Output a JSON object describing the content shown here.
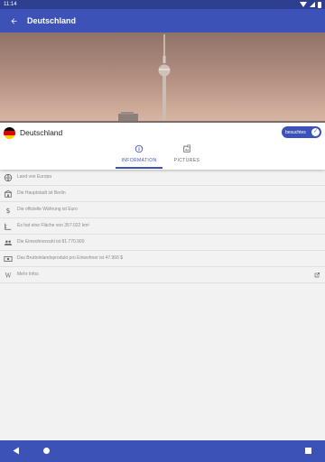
{
  "status_bar": {
    "time": "11:14"
  },
  "app_bar": {
    "title": "Deutschland"
  },
  "country": {
    "name": "Deutschland",
    "flag_colors": [
      "#000000",
      "#dd0000",
      "#ffce00"
    ],
    "visited_label": "besuchtes"
  },
  "tabs": [
    {
      "label": "INFORMATION",
      "icon": "info-icon",
      "selected": true
    },
    {
      "label": "PICTURES",
      "icon": "pictures-icon",
      "selected": false
    }
  ],
  "info_items": [
    {
      "icon": "globe-icon",
      "text": "Land von Europa"
    },
    {
      "icon": "building-icon",
      "text": "Die Hauptstadt ist Berlin"
    },
    {
      "icon": "dollar-icon",
      "text": "Die offizielle Währung ist Euro"
    },
    {
      "icon": "area-icon",
      "text": "Es hat eine Fläche von 357.022 km²"
    },
    {
      "icon": "people-icon",
      "text": "Die Einwohnerzahl ist 81.770.900"
    },
    {
      "icon": "money-icon",
      "text": "Das Bruttoinlandsprodukt pro Einwohner ist 47.966 $"
    },
    {
      "icon": "wikipedia-icon",
      "text": "Mehr Infos",
      "external": true
    }
  ],
  "colors": {
    "primary": "#3c52b6",
    "status_bar": "#2f3f8f",
    "accent_flag_black": "#000000",
    "accent_flag_red": "#dd0000",
    "accent_flag_gold": "#ffce00"
  }
}
